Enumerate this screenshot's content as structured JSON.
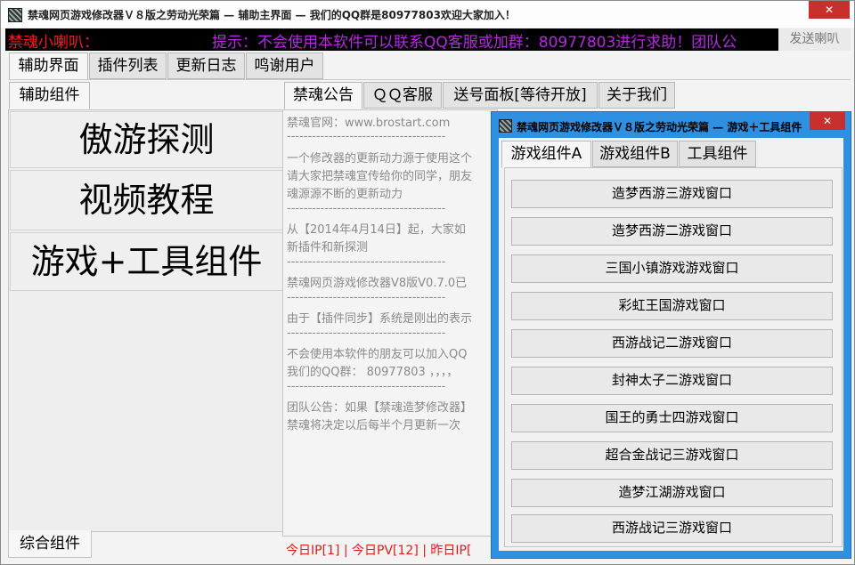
{
  "window": {
    "title": "禁魂网页游戏修改器Ｖ８版之劳动光荣篇 — 辅助主界面 — 我们的QQ群是80977803欢迎大家加入！",
    "close_symbol": "✕"
  },
  "marquee": {
    "label": "禁魂小喇叭：",
    "text": "提示：不会使用本软件可以联系QQ客服或加群：80977803进行求助！团队公",
    "send_button": "发送喇叭"
  },
  "main_tabs": [
    "辅助界面",
    "插件列表",
    "更新日志",
    "鸣谢用户"
  ],
  "left_panel": {
    "tab": "辅助组件",
    "buttons": [
      "傲游探测",
      "视频教程",
      "游戏+工具组件"
    ],
    "footer_tab": "综合组件"
  },
  "center_tabs": [
    "禁魂公告",
    "ＱＱ客服",
    "送号面板[等待开放]",
    "关于我们"
  ],
  "notice_lines": [
    "禁魂官网：www.brostart.com",
    "--------------------------------------",
    "一个修改器的更新动力源于使用这个",
    "请大家把禁魂宣传给你的同学，朋友",
    "魂源源不断的更新动力",
    "--------------------------------------",
    "从【2014年4月14日】起，大家如",
    "新插件和新探测",
    "--------------------------------------",
    "禁魂网页游戏修改器V8版V0.7.0已",
    "--------------------------------------",
    "由于【插件同步】系统是刚出的表示",
    "--------------------------------------",
    "不会使用本软件的朋友可以加入QQ",
    "我们的QQ群： 80977803 ，，，，",
    "--------------------------------------",
    "团队公告：如果【禁魂造梦修改器】",
    "禁魂将决定以后每半个月更新一次"
  ],
  "status": "今日IP[1] | 今日PV[12] | 昨日IP[",
  "dialog": {
    "title": "禁魂网页游戏修改器Ｖ８版之劳动光荣篇 — 游戏＋工具组件",
    "close_symbol": "✕",
    "tabs": [
      "游戏组件A",
      "游戏组件B",
      "工具组件"
    ],
    "buttons": [
      "造梦西游三游戏窗口",
      "造梦西游二游戏窗口",
      "三国小镇游戏游戏窗口",
      "彩虹王国游戏窗口",
      "西游战记二游戏窗口",
      "封神太子二游戏窗口",
      "国王的勇士四游戏窗口",
      "超合金战记三游戏窗口",
      "造梦江湖游戏窗口",
      "西游战记三游戏窗口"
    ]
  }
}
